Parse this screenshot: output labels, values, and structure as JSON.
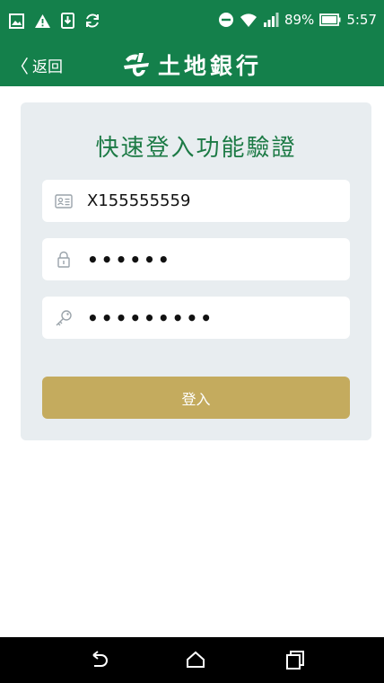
{
  "statusbar": {
    "battery_pct": "89%",
    "time": "5:57",
    "icons_left": [
      "image-icon",
      "warning-icon",
      "download-icon",
      "sync-icon"
    ],
    "icons_right": [
      "do-not-disturb-icon",
      "wifi-icon",
      "signal-icon",
      "battery-icon"
    ]
  },
  "appbar": {
    "back_label": "返回",
    "brand_name": "土地銀行",
    "background": "#14804b"
  },
  "form": {
    "title": "快速登入功能驗證",
    "id_value": "X155555559",
    "password_value": "••••••",
    "code_value": "•••••••••",
    "login_label": "登入",
    "accent_title": "#1c7a45",
    "button_color": "#c4ab5e"
  },
  "navbar": {
    "buttons": [
      "back-icon",
      "home-icon",
      "recents-icon"
    ]
  }
}
